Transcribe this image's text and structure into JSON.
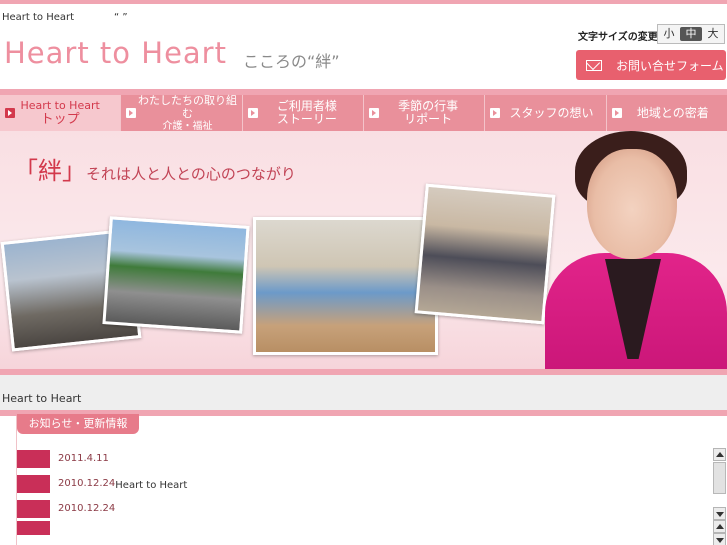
{
  "header": {
    "tagline": "Heart to Heart　　　　“ ” 　　　　　　　　　　　　　　　　　　　　　　",
    "logo": "Heart to Heart",
    "logo_sub": "こころの“絆”",
    "font_size_label": "文字サイズの変更",
    "font_size_options": [
      "小",
      "中",
      "大"
    ],
    "font_size_selected": "中",
    "contact_button": "お問い合せフォーム",
    "contact_icon": "mail-icon"
  },
  "nav": {
    "items": [
      {
        "line1": "Heart to Heart",
        "line2": "トップ",
        "active": true
      },
      {
        "line1": "わたしたちの取り組む",
        "line2": "介護・福祉",
        "active": false
      },
      {
        "line1": "ご利用者様",
        "line2": "ストーリー",
        "active": false
      },
      {
        "line1": "季節の行事",
        "line2": "リポート",
        "active": false
      },
      {
        "line1": "スタッフの想い",
        "line2": "",
        "active": false
      },
      {
        "line1": "地域との密着",
        "line2": "",
        "active": false
      }
    ]
  },
  "hero": {
    "title_kanji": "「絆」",
    "title_rest": "それは人と人との心のつながり"
  },
  "breadcrumb": "Heart to Heart　   ",
  "news": {
    "tab_label": "お知らせ・更新情報",
    "rows": [
      {
        "badge": "　　",
        "date": "2011.4.11",
        "link": "　　　　　　　　　 　　　　　　",
        "text": "　　　　　　　　　　　　　　"
      },
      {
        "badge": "　　",
        "date": "2010.12.24",
        "link": "Heart to Heart",
        "text": "　　　　　　　　　　"
      },
      {
        "badge": "　　",
        "date": "2010.12.24",
        "link": "　　　　　　 　　　　　　　",
        "text": "　　　　　　　　　　"
      },
      {
        "badge": "　　",
        "date": "",
        "link": "",
        "text": ""
      }
    ]
  },
  "colors": {
    "accent_pink": "#f0a5b2",
    "nav_pink": "#e9909b",
    "contact_red": "#e8606e",
    "badge_red": "#c92f58",
    "title_red": "#d3394c"
  }
}
